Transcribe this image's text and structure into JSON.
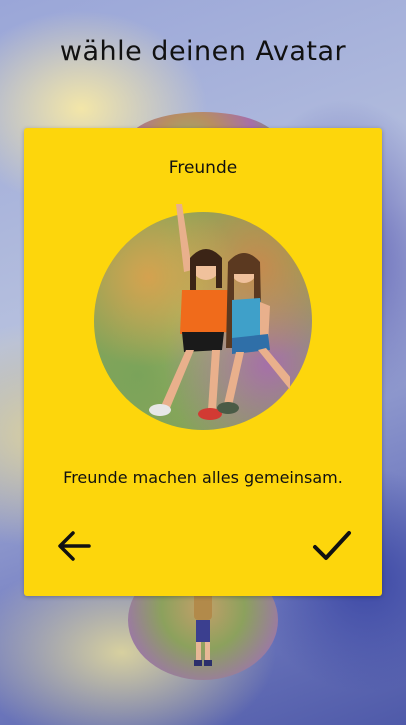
{
  "header": {
    "title": "wähle deinen Avatar"
  },
  "card": {
    "title": "Freunde",
    "description": "Freunde machen alles gemeinsam.",
    "background_color": "#fdd60c"
  },
  "actions": {
    "back_icon": "arrow-left-icon",
    "confirm_icon": "checkmark-icon"
  }
}
